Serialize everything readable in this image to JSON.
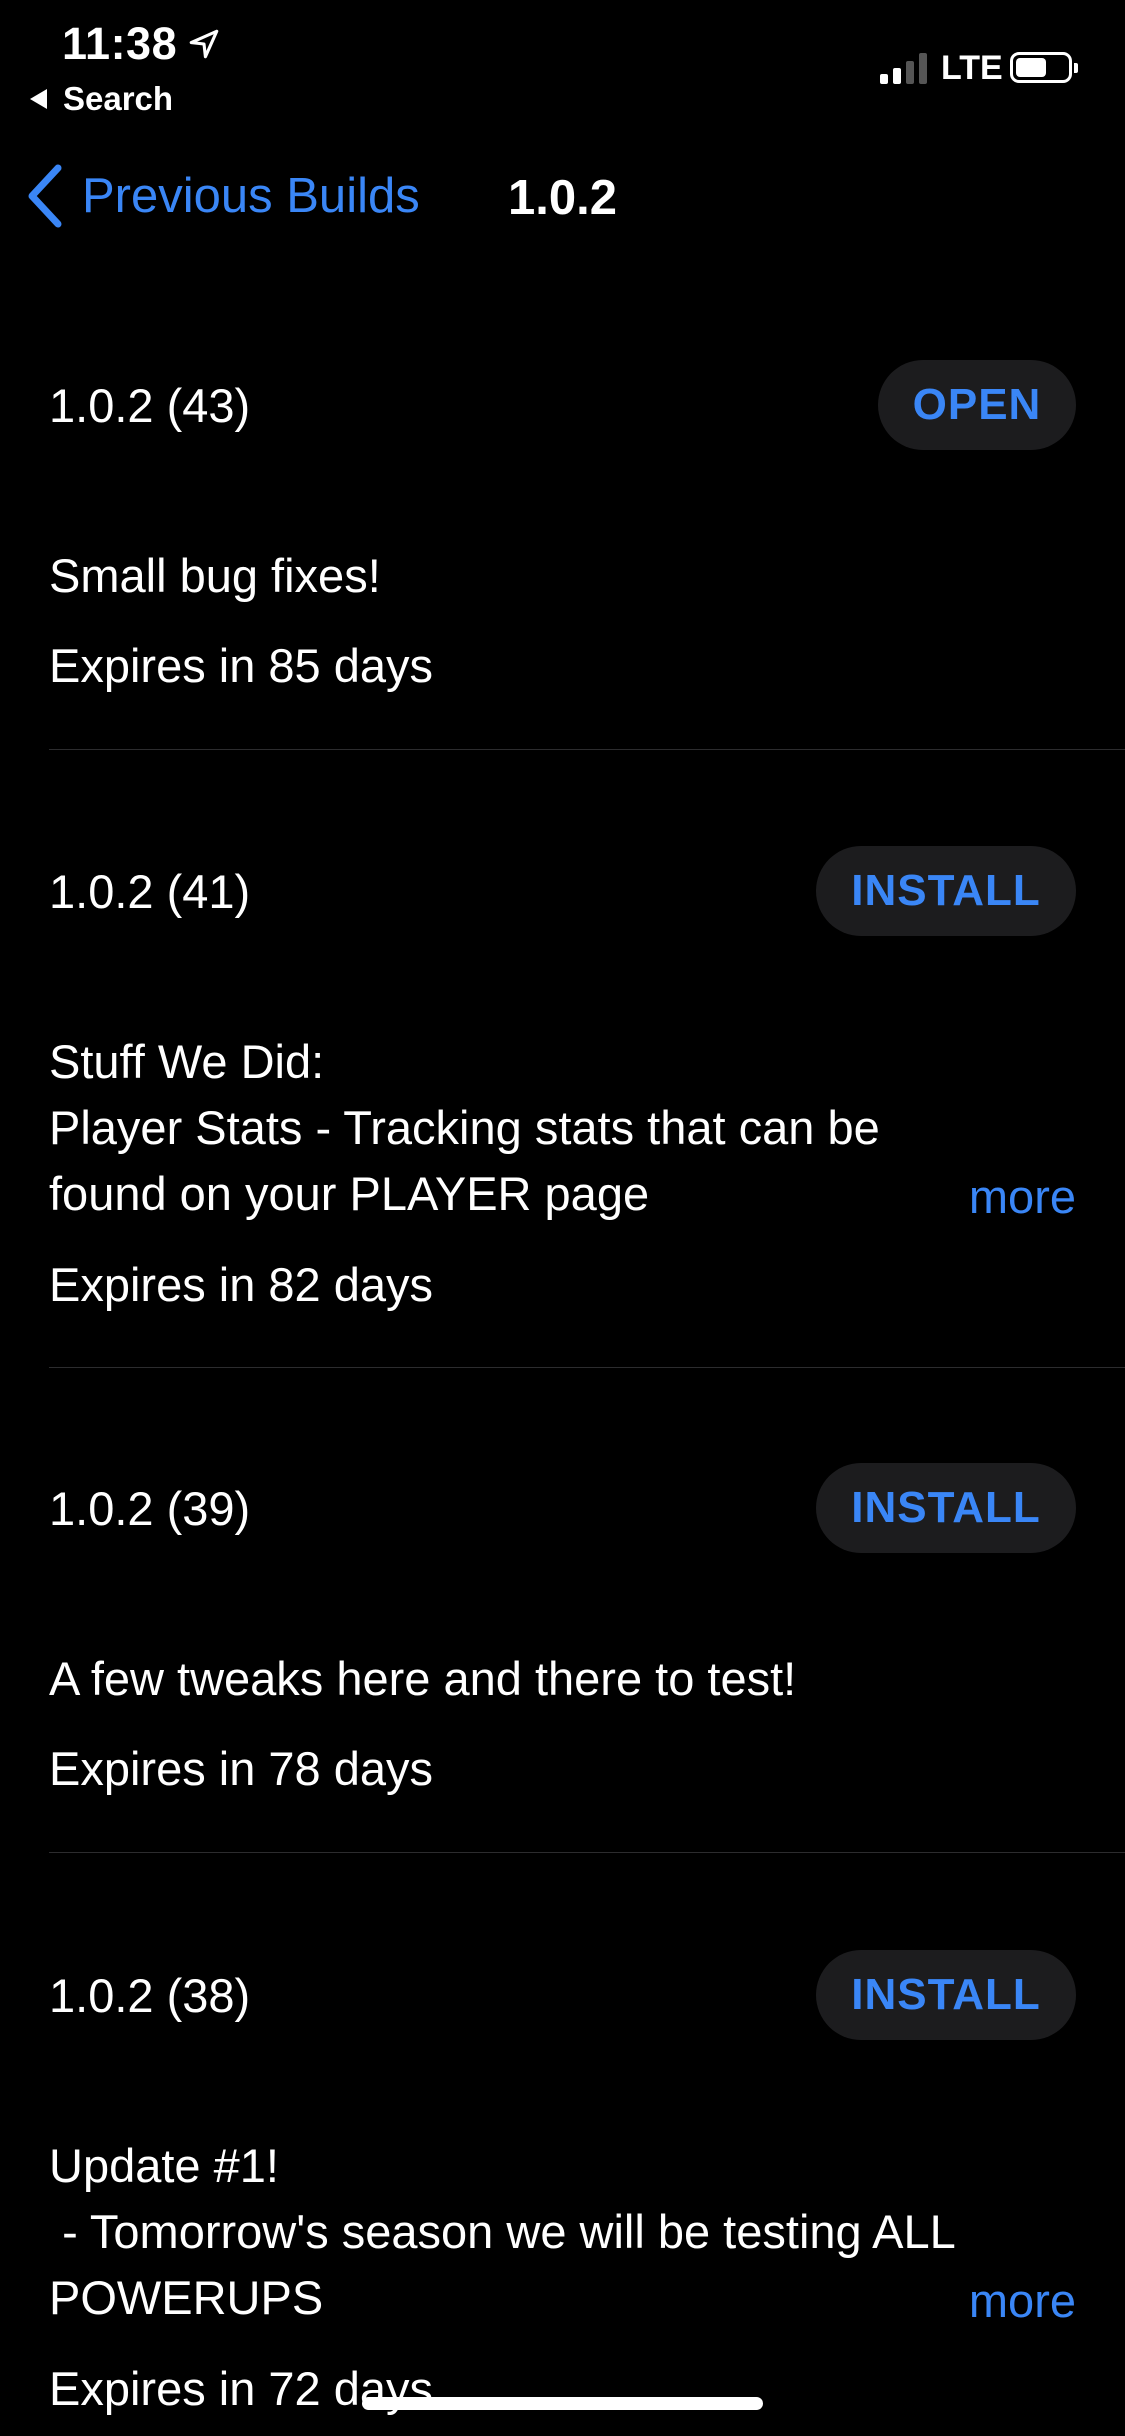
{
  "status_bar": {
    "time": "11:38",
    "back_app_label": "Search",
    "network": "LTE"
  },
  "nav": {
    "back_label": "Previous Builds",
    "title": "1.0.2"
  },
  "builds": [
    {
      "version": "1.0.2 (43)",
      "action": "OPEN",
      "notes": "Small bug fixes!",
      "expires": "Expires in 85 days"
    },
    {
      "version": "1.0.2 (41)",
      "action": "INSTALL",
      "notes": "Stuff We Did:\nPlayer Stats - Tracking stats that can be\nfound on your PLAYER page",
      "more": "more",
      "expires": "Expires in 82 days"
    },
    {
      "version": "1.0.2 (39)",
      "action": "INSTALL",
      "notes": "A few tweaks here and there to test!",
      "expires": "Expires in 78 days"
    },
    {
      "version": "1.0.2 (38)",
      "action": "INSTALL",
      "notes": "Update #1!\n - Tomorrow's season we will be testing ALL\nPOWERUPS",
      "more": "more",
      "expires": "Expires in 72 days"
    }
  ],
  "colors": {
    "accent": "#3a86f6",
    "background": "#000000",
    "button_bg": "#1c1c1e",
    "divider": "#2c2c2e"
  }
}
